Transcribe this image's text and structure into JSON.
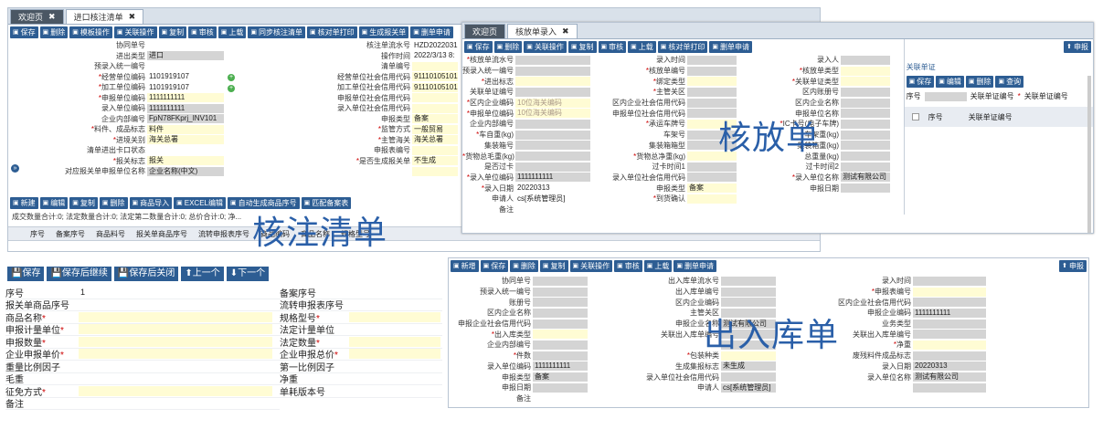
{
  "p1": {
    "tabs": [
      "欢迎页",
      "进口核注清单"
    ],
    "toolbar": [
      "保存",
      "删除",
      "模板操作",
      "关联操作",
      "复制",
      "审核",
      "上载",
      "同步核注清单",
      "核对单打印",
      "生成报关单",
      "删单申请"
    ],
    "rows": [
      {
        "l1": "协同单号",
        "v1": "",
        "l2": "核注单流水号",
        "v2": "HZD2022031"
      },
      {
        "l1": "进出类型",
        "v1": "进口",
        "l2": "操作时间",
        "v2": "2022/3/13 8:"
      },
      {
        "l1": "预录入统一编号",
        "v1": "",
        "l2": "清单编号",
        "v2": ""
      },
      {
        "l1": "经营单位编码",
        "v1": "1101919107",
        "l2": "经营单位社会信用代码",
        "v2": "91110105101"
      },
      {
        "l1": "加工单位编码",
        "v1": "1101919107",
        "l2": "加工单位社会信用代码",
        "v2": "91110105101"
      },
      {
        "l1": "申报单位编码",
        "v1": "1111111111",
        "l2": "申报单位社会信用代码",
        "v2": ""
      },
      {
        "l1": "录入单位编码",
        "v1": "1111111111",
        "l2": "录入单位社会信用代码",
        "v2": ""
      },
      {
        "l1": "企业内部编号",
        "v1": "FpN78FKprj_INV101",
        "l2": "申报类型",
        "v2": "备案"
      },
      {
        "l1": "料件、成品标志",
        "v1": "料件",
        "l2": "监管方式",
        "v2": "一般贸易"
      },
      {
        "l1": "进境关别",
        "v1": "海关总署",
        "l2": "主管海关",
        "v2": "海关总署"
      },
      {
        "l1": "清单进出卡口状态",
        "v1": "",
        "l2": "申报表编号",
        "v2": ""
      },
      {
        "l1": "报关标志",
        "v1": "报关",
        "l2": "是否生成报关单",
        "v2": "不生成"
      },
      {
        "l1": "对应报关单申报单位名称",
        "v1": "企业名称(中文)",
        "l2": "",
        "v2": ""
      }
    ],
    "cut_labels": [
      "清",
      "录",
      "核",
      "报"
    ],
    "toolbar2": [
      "新建",
      "编辑",
      "复制",
      "删除",
      "商品导入",
      "EXCEL编辑",
      "自动生成商品序号",
      "匹配备案表"
    ],
    "summary": "成交数量合计:0; 法定数量合计:0; 法定第二数量合计:0; 总价合计:0; 净...",
    "columns": [
      "序号",
      "备案序号",
      "商品料号",
      "报关单商品序号",
      "流转申报表序号",
      "商品编码",
      "商品名称",
      "规格型号"
    ],
    "watermark": "核注清单"
  },
  "p2": {
    "tabs": [
      "欢迎页",
      "核放单录入"
    ],
    "toolbar": [
      "保存",
      "删除",
      "关联操作",
      "复制",
      "审核",
      "上载",
      "核对单打印",
      "删单申请"
    ],
    "right_btn": "申报",
    "rows": [
      [
        "核放单流水号",
        "",
        "录入时间",
        "",
        "录入人",
        ""
      ],
      [
        "预录入统一编号",
        "",
        "核放单编号",
        "",
        "核放单类型",
        ""
      ],
      [
        "进出标志",
        "",
        "绑定类型",
        "",
        "关联单证类型",
        ""
      ],
      [
        "关联单证编号",
        "",
        "主管关区",
        "",
        "区内账册号",
        ""
      ],
      [
        "区内企业编码",
        "10位海关编码",
        "区内企业社会信用代码",
        "",
        "区内企业名称",
        ""
      ],
      [
        "申报单位编码",
        "10位海关编码",
        "申报单位社会信用代码",
        "",
        "申报单位名称",
        ""
      ],
      [
        "企业内部编号",
        "",
        "承运车牌号",
        "",
        "IC卡号(电子车牌)",
        ""
      ],
      [
        "车自重(kg)",
        "",
        "车架号",
        "",
        "车架重(kg)",
        ""
      ],
      [
        "集装箱号",
        "",
        "集装箱箱型",
        "",
        "集装箱重(kg)",
        ""
      ],
      [
        "货物总毛重(kg)",
        "",
        "货物总净重(kg)",
        "",
        "总重量(kg)",
        ""
      ],
      [
        "是否过卡",
        "",
        "过卡时间1",
        "",
        "过卡时间2",
        ""
      ],
      [
        "录入单位编码",
        "1111111111",
        "录入单位社会信用代码",
        "",
        "录入单位名称",
        "测试有限公司"
      ],
      [
        "录入日期",
        "20220313",
        "申报类型",
        "备案",
        "申报日期",
        ""
      ],
      [
        "申请人",
        "cs[系统管理员]",
        "到货确认",
        "",
        "",
        ""
      ],
      [
        "备注",
        "",
        "",
        "",
        "",
        ""
      ]
    ],
    "sub_title": "关联单证",
    "sub_toolbar": [
      "保存",
      "编辑",
      "删除",
      "查询"
    ],
    "sub_fields": [
      "序号",
      "关联单证编号"
    ],
    "sub_cols": [
      "序号",
      "关联单证编号"
    ],
    "watermark": "核放单"
  },
  "p3": {
    "buttons": [
      "保存",
      "保存后继续",
      "保存后关闭",
      "上一个",
      "下一个"
    ],
    "left": [
      {
        "l": "序号",
        "v": "1",
        "req": false
      },
      {
        "l": "报关单商品序号",
        "v": "",
        "req": false
      },
      {
        "l": "商品名称",
        "v": "",
        "req": true
      },
      {
        "l": "申报计量单位",
        "v": "",
        "req": true
      },
      {
        "l": "申报数量",
        "v": "",
        "req": true
      },
      {
        "l": "企业申报单价",
        "v": "",
        "req": true
      },
      {
        "l": "重量比例因子",
        "v": "",
        "req": false
      },
      {
        "l": "毛重",
        "v": "",
        "req": false
      },
      {
        "l": "征免方式",
        "v": "",
        "req": true
      },
      {
        "l": "备注",
        "v": "",
        "req": false
      }
    ],
    "right": [
      {
        "l": "备案序号",
        "v": "",
        "req": false
      },
      {
        "l": "流转申报表序号",
        "v": "",
        "req": false
      },
      {
        "l": "规格型号",
        "v": "",
        "req": true
      },
      {
        "l": "法定计量单位",
        "v": "",
        "req": false
      },
      {
        "l": "法定数量",
        "v": "",
        "req": true
      },
      {
        "l": "企业申报总价",
        "v": "",
        "req": true
      },
      {
        "l": "第一比例因子",
        "v": "",
        "req": false
      },
      {
        "l": "净重",
        "v": "",
        "req": false
      },
      {
        "l": "单耗版本号",
        "v": "",
        "req": false
      }
    ]
  },
  "p4": {
    "toolbar": [
      "新增",
      "保存",
      "删除",
      "复制",
      "关联操作",
      "审核",
      "上载",
      "删单申请"
    ],
    "right_btn": "申报",
    "rows": [
      [
        "协同单号",
        "",
        "出入库单流水号",
        "",
        "录入时间",
        ""
      ],
      [
        "预录入统一编号",
        "",
        "出入库单编号",
        "",
        "申报表编号",
        ""
      ],
      [
        "账册号",
        "",
        "区内企业编码",
        "",
        "区内企业社会信用代码",
        ""
      ],
      [
        "区内企业名称",
        "",
        "主管关区",
        "",
        "申报企业编码",
        "1111111111"
      ],
      [
        "申报企业社会信用代码",
        "",
        "申报企业名称",
        "测试有限公司",
        "业务类型",
        ""
      ],
      [
        "出入库类型",
        "",
        "关联出入库单编号",
        "",
        "关联出入库单编号",
        ""
      ],
      [
        "企业内部编号",
        "",
        "",
        "",
        "净重",
        ""
      ],
      [
        "件数",
        "",
        "包装种类",
        "",
        "废残料件成品标志",
        ""
      ],
      [
        "录入单位编码",
        "1111111111",
        "生成集报标志",
        "未生成",
        "录入日期",
        "20220313"
      ],
      [
        "申报类型",
        "备案",
        "录入单位社会信用代码",
        "",
        "录入单位名称",
        "测试有限公司"
      ],
      [
        "申报日期",
        "",
        "申请人",
        "cs[系统管理员]",
        "",
        ""
      ],
      [
        "备注",
        "",
        "",
        "",
        "",
        ""
      ]
    ],
    "watermark": "出入库单"
  }
}
